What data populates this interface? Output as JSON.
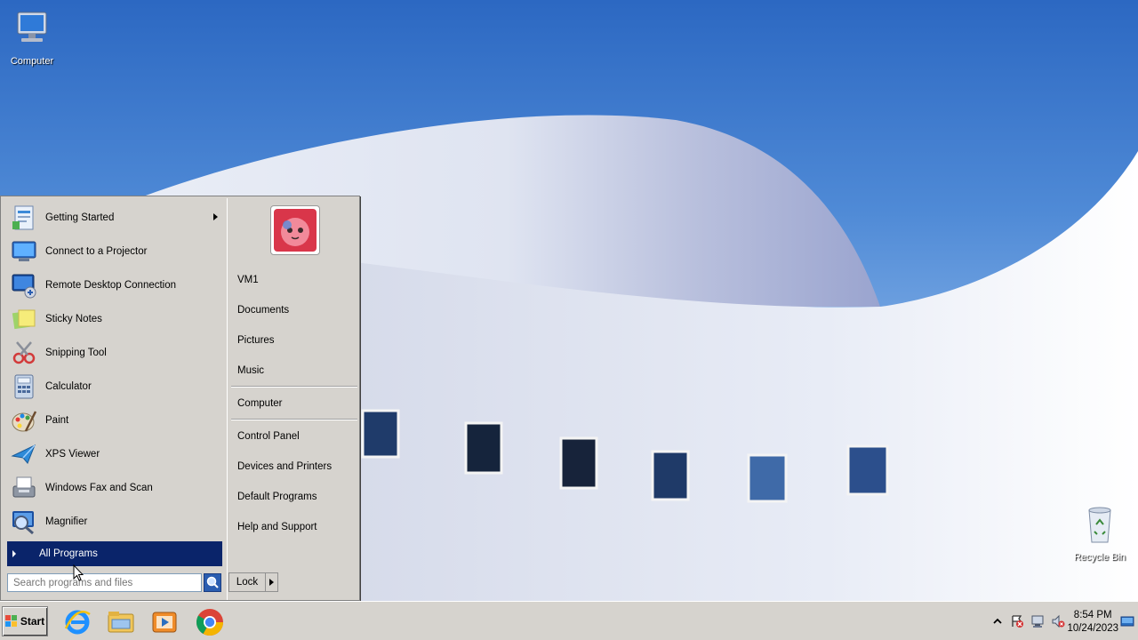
{
  "desktop": {
    "icons": [
      {
        "label": "Computer",
        "icon": "computer-icon"
      },
      {
        "label": "Recycle Bin",
        "icon": "recycle-bin-icon"
      }
    ]
  },
  "start_menu": {
    "programs": [
      {
        "label": "Getting Started",
        "icon": "getting-started-icon",
        "has_submenu": true
      },
      {
        "label": "Connect to a Projector",
        "icon": "projector-icon"
      },
      {
        "label": "Remote Desktop Connection",
        "icon": "remote-desktop-icon"
      },
      {
        "label": "Sticky Notes",
        "icon": "sticky-notes-icon"
      },
      {
        "label": "Snipping Tool",
        "icon": "snipping-tool-icon"
      },
      {
        "label": "Calculator",
        "icon": "calculator-icon"
      },
      {
        "label": "Paint",
        "icon": "paint-icon"
      },
      {
        "label": "XPS Viewer",
        "icon": "xps-viewer-icon"
      },
      {
        "label": "Windows Fax and Scan",
        "icon": "fax-scan-icon"
      },
      {
        "label": "Magnifier",
        "icon": "magnifier-icon"
      }
    ],
    "all_programs_label": "All Programs",
    "search_placeholder": "Search programs and files",
    "right_items": [
      {
        "label": "VM1"
      },
      {
        "label": "Documents"
      },
      {
        "label": "Pictures"
      },
      {
        "label": "Music"
      },
      {
        "label": "Computer"
      },
      {
        "label": "Control Panel"
      },
      {
        "label": "Devices and Printers"
      },
      {
        "label": "Default Programs"
      },
      {
        "label": "Help and Support"
      }
    ],
    "lock_label": "Lock",
    "accent_color": "#0a246a"
  },
  "taskbar": {
    "start_label": "Start",
    "pinned": [
      {
        "icon": "internet-explorer-icon"
      },
      {
        "icon": "file-explorer-icon"
      },
      {
        "icon": "media-player-icon"
      },
      {
        "icon": "chrome-icon"
      }
    ],
    "clock_time": "8:54 PM",
    "clock_date": "10/24/2023"
  }
}
